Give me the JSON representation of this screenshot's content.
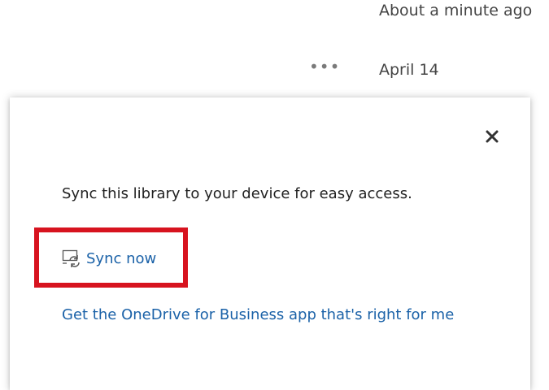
{
  "background": {
    "modified_top": "About a minute ago",
    "modified_date": "April 14",
    "more_label": "•••"
  },
  "callout": {
    "message": "Sync this library to your device for easy access.",
    "sync_label": "Sync now",
    "app_link_label": "Get the OneDrive for Business app that's right for me",
    "close_icon": "close-icon",
    "sync_icon": "sync-device-icon",
    "highlight_color": "#d7131f",
    "link_color": "#1b62a8"
  }
}
